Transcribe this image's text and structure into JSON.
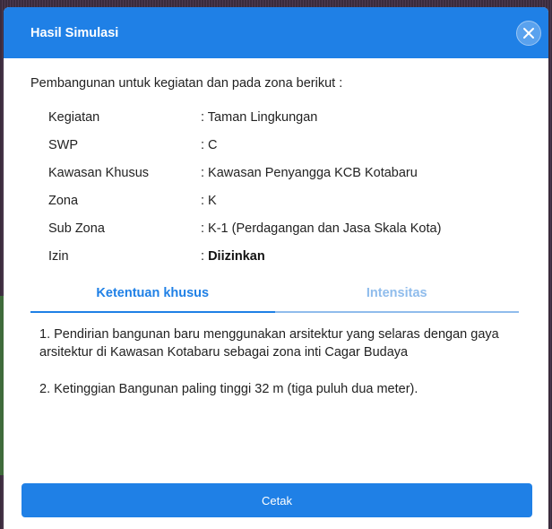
{
  "modal": {
    "title": "Hasil Simulasi",
    "intro": "Pembangunan untuk kegiatan dan pada zona berikut :",
    "rows": [
      {
        "label": "Kegiatan",
        "value": ": Taman Lingkungan"
      },
      {
        "label": "SWP",
        "value": ": C"
      },
      {
        "label": "Kawasan Khusus",
        "value": ": Kawasan Penyangga KCB Kotabaru"
      },
      {
        "label": "Zona",
        "value": ": K"
      },
      {
        "label": "Sub Zona",
        "value": ": K-1 (Perdagangan dan Jasa Skala Kota)"
      },
      {
        "label": "Izin",
        "prefix": ": ",
        "value": "Diizinkan"
      }
    ],
    "tabs": [
      {
        "label": "Ketentuan khusus"
      },
      {
        "label": "Intensitas"
      }
    ],
    "provisions": [
      "1. Pendirian bangunan baru menggunakan arsitektur yang selaras dengan gaya arsitektur di Kawasan Kotabaru sebagai zona inti Cagar Budaya",
      "2. Ketinggian Bangunan paling tinggi 32 m (tiga puluh dua meter)."
    ],
    "print_label": "Cetak"
  },
  "colors": {
    "header": "#1f80e6",
    "tab_active": "#1f80e6",
    "tab_inactive": "#8fbcec"
  },
  "icons": {
    "close": "close-icon"
  }
}
